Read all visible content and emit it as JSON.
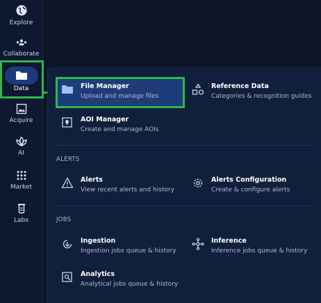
{
  "sidebar": {
    "items": [
      {
        "key": "explore",
        "label": "Explore",
        "icon": "globe-icon"
      },
      {
        "key": "collaborate",
        "label": "Collaborate",
        "icon": "users-icon"
      },
      {
        "key": "data",
        "label": "Data",
        "icon": "folder-icon",
        "active": true
      },
      {
        "key": "acquire",
        "label": "Acquire",
        "icon": "image-icon"
      },
      {
        "key": "ai",
        "label": "AI",
        "icon": "leaf-icon"
      },
      {
        "key": "market",
        "label": "Market",
        "icon": "grid-dots-icon"
      },
      {
        "key": "labs",
        "label": "Labs",
        "icon": "flask-icon"
      }
    ]
  },
  "menu": {
    "file_manager": {
      "title": "File Manager",
      "subtitle": "Upload and manage files",
      "icon": "folder-icon"
    },
    "reference_data": {
      "title": "Reference Data",
      "subtitle": "Categories & recognition guides",
      "icon": "shapes-icon"
    },
    "aoi_manager": {
      "title": "AOI Manager",
      "subtitle": "Create and manage AOIs",
      "icon": "map-pin-icon"
    },
    "alerts_section": "ALERTS",
    "alerts": {
      "title": "Alerts",
      "subtitle": "View recent alerts and history",
      "icon": "warning-icon"
    },
    "alerts_config": {
      "title": "Alerts Configuration",
      "subtitle": "Create & configure alerts",
      "icon": "gear-icon"
    },
    "jobs_section": "JOBS",
    "ingestion": {
      "title": "Ingestion",
      "subtitle": "Ingestion jobs queue & history",
      "icon": "ingest-icon"
    },
    "inference": {
      "title": "Inference",
      "subtitle": "Inference jobs queue & history",
      "icon": "network-icon"
    },
    "analytics": {
      "title": "Analytics",
      "subtitle": "Analytical jobs queue & history",
      "icon": "analytics-icon"
    }
  },
  "colors": {
    "highlight": "#2db84a",
    "active_bg": "#1f3c7a",
    "panel_bg": "#10203c"
  }
}
